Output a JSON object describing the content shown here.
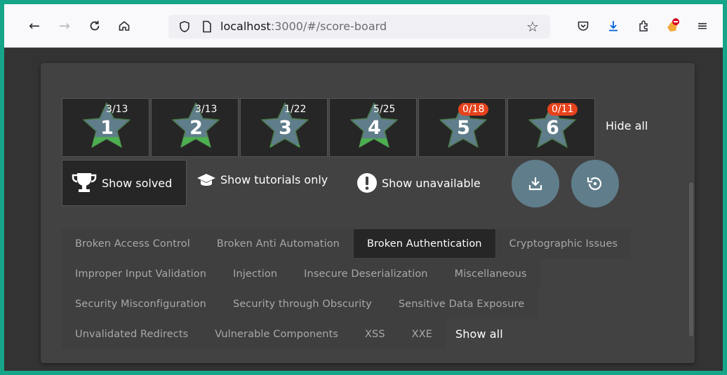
{
  "browser": {
    "url_host": "localhost",
    "url_rest": ":3000/#/score-board"
  },
  "difficulty": [
    {
      "level": "1",
      "count": "3/13",
      "badge": false,
      "solved_fraction": 0.23
    },
    {
      "level": "2",
      "count": "3/13",
      "badge": false,
      "solved_fraction": 0.23
    },
    {
      "level": "3",
      "count": "1/22",
      "badge": false,
      "solved_fraction": 0.05
    },
    {
      "level": "4",
      "count": "5/25",
      "badge": false,
      "solved_fraction": 0.2
    },
    {
      "level": "5",
      "count": "0/18",
      "badge": true,
      "solved_fraction": 0
    },
    {
      "level": "6",
      "count": "0/11",
      "badge": true,
      "solved_fraction": 0
    }
  ],
  "hide_all": "Hide all",
  "filters": {
    "solved": "Show solved",
    "tutorials": "Show tutorials only",
    "unavailable": "Show unavailable"
  },
  "categories": [
    [
      "Broken Access Control",
      "Broken Anti Automation",
      "Broken Authentication",
      "Cryptographic Issues"
    ],
    [
      "Improper Input Validation",
      "Injection",
      "Insecure Deserialization",
      "Miscellaneous"
    ],
    [
      "Security Misconfiguration",
      "Security through Obscurity",
      "Sensitive Data Exposure"
    ],
    [
      "Unvalidated Redirects",
      "Vulnerable Components",
      "XSS",
      "XXE"
    ]
  ],
  "active_category": "Broken Authentication",
  "show_all": "Show all",
  "colors": {
    "star": "#607d8b",
    "solved": "#4caf50",
    "badge": "#e6421c",
    "accent_teal": "#17a589"
  }
}
